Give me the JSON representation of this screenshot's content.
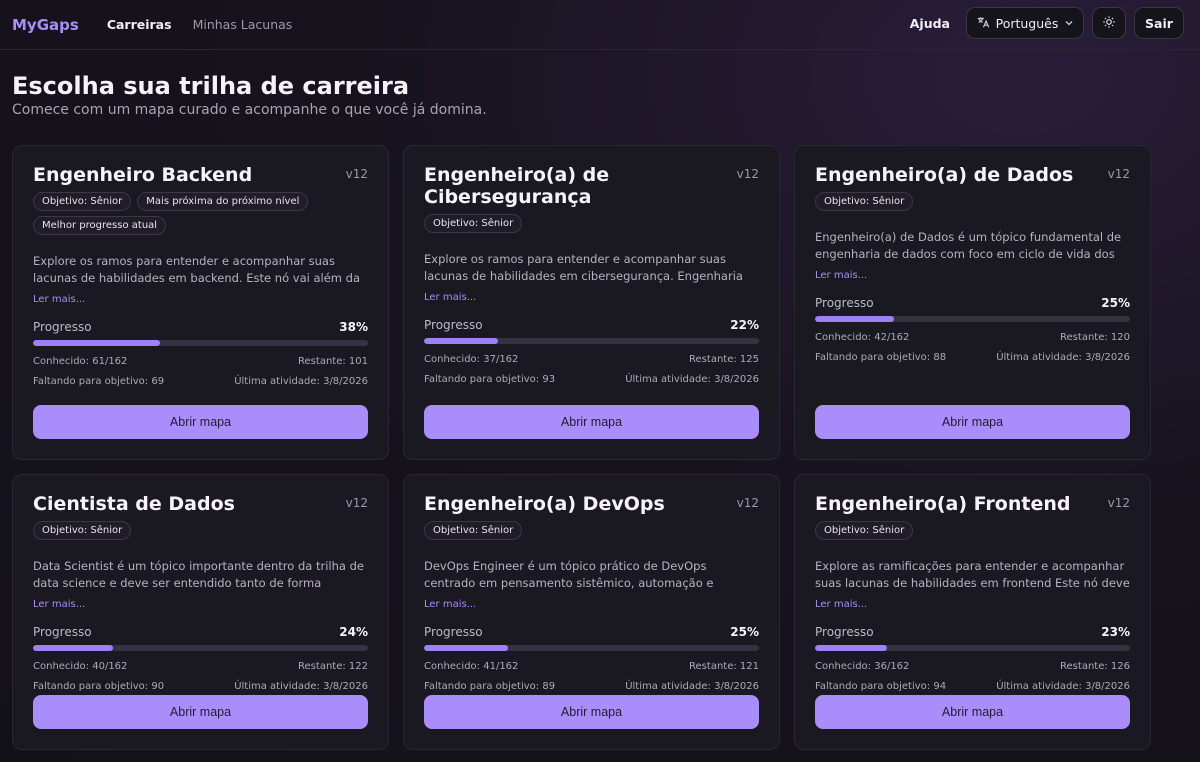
{
  "header": {
    "logo": "MyGaps",
    "nav": [
      {
        "label": "Carreiras",
        "active": true
      },
      {
        "label": "Minhas Lacunas",
        "active": false
      }
    ],
    "help": "Ajuda",
    "language": "Português",
    "logout": "Sair",
    "icons": {
      "language": "translate-icon",
      "chevron": "chevron-down-icon",
      "theme": "sun-icon"
    }
  },
  "page": {
    "title": "Escolha sua trilha de carreira",
    "subtitle": "Comece com um mapa curado e acompanhe o que você já domina."
  },
  "labels": {
    "progress": "Progresso",
    "read_more": "Ler mais...",
    "open_map": "Abrir mapa"
  },
  "accent": "#a98dfb",
  "cards": [
    {
      "title": "Engenheiro Backend",
      "version": "v12",
      "badges": [
        "Objetivo: Sênior",
        "Mais próxima do próximo nível",
        "Melhor progresso atual"
      ],
      "description": "Explore os ramos para entender e acompanhar suas lacunas de habilidades em backend. Este nó vai além da familiaridade…",
      "progress_pct": "38%",
      "progress_value": 38,
      "known": "Conhecido: 61/162",
      "remaining": "Restante: 101",
      "missing": "Faltando para objetivo: 69",
      "last_activity": "Última atividade: 3/8/2026"
    },
    {
      "title": "Engenheiro(a) de Cibersegurança",
      "version": "v12",
      "badges": [
        "Objetivo: Sênior"
      ],
      "description": "Explore os ramos para entender e acompanhar suas lacunas de habilidades em cibersegurança. Engenharia de…",
      "progress_pct": "22%",
      "progress_value": 22,
      "known": "Conhecido: 37/162",
      "remaining": "Restante: 125",
      "missing": "Faltando para objetivo: 93",
      "last_activity": "Última atividade: 3/8/2026"
    },
    {
      "title": "Engenheiro(a) de Dados",
      "version": "v12",
      "badges": [
        "Objetivo: Sênior"
      ],
      "description": "Engenheiro(a) de Dados é um tópico fundamental de engenharia de dados com foco em ciclo de vida dos dados,…",
      "progress_pct": "25%",
      "progress_value": 25,
      "known": "Conhecido: 42/162",
      "remaining": "Restante: 120",
      "missing": "Faltando para objetivo: 88",
      "last_activity": "Última atividade: 3/8/2026"
    },
    {
      "title": "Cientista de Dados",
      "version": "v12",
      "badges": [
        "Objetivo: Sênior"
      ],
      "description": "Data Scientist é um tópico importante dentro da trilha de data science e deve ser entendido tanto de forma conceitu…",
      "progress_pct": "24%",
      "progress_value": 24,
      "known": "Conhecido: 40/162",
      "remaining": "Restante: 122",
      "missing": "Faltando para objetivo: 90",
      "last_activity": "Última atividade: 3/8/2026"
    },
    {
      "title": "Engenheiro(a) DevOps",
      "version": "v12",
      "badges": [
        "Objetivo: Sênior"
      ],
      "description": "DevOps Engineer é um tópico prático de DevOps centrado em pensamento sistêmico, automação e confiabilidade…",
      "progress_pct": "25%",
      "progress_value": 25,
      "known": "Conhecido: 41/162",
      "remaining": "Restante: 121",
      "missing": "Faltando para objetivo: 89",
      "last_activity": "Última atividade: 3/8/2026"
    },
    {
      "title": "Engenheiro(a) Frontend",
      "version": "v12",
      "badges": [
        "Objetivo: Sênior"
      ],
      "description": "Explore as ramificações para entender e acompanhar suas lacunas de habilidades em frontend Este nó deve ajudar o(…",
      "progress_pct": "23%",
      "progress_value": 23,
      "known": "Conhecido: 36/162",
      "remaining": "Restante: 126",
      "missing": "Faltando para objetivo: 94",
      "last_activity": "Última atividade: 3/8/2026"
    }
  ]
}
